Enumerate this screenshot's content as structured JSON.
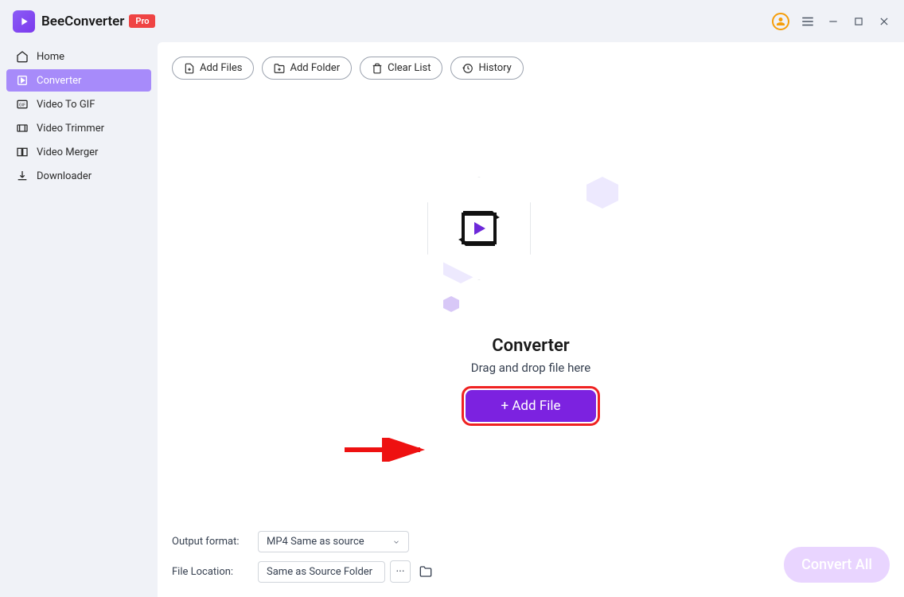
{
  "app": {
    "name": "BeeConverter",
    "badge": "Pro"
  },
  "sidebar": {
    "items": [
      {
        "label": "Home"
      },
      {
        "label": "Converter"
      },
      {
        "label": "Video To GIF"
      },
      {
        "label": "Video Trimmer"
      },
      {
        "label": "Video Merger"
      },
      {
        "label": "Downloader"
      }
    ]
  },
  "toolbar": {
    "add_files": "Add Files",
    "add_folder": "Add Folder",
    "clear_list": "Clear List",
    "history": "History"
  },
  "center": {
    "title": "Converter",
    "subtitle": "Drag and drop file here",
    "add_file": "+ Add File"
  },
  "footer": {
    "output_format_label": "Output format:",
    "output_format_value": "MP4 Same as source",
    "file_location_label": "File Location:",
    "file_location_value": "Same as Source Folder",
    "more": "···",
    "convert_all": "Convert All"
  }
}
